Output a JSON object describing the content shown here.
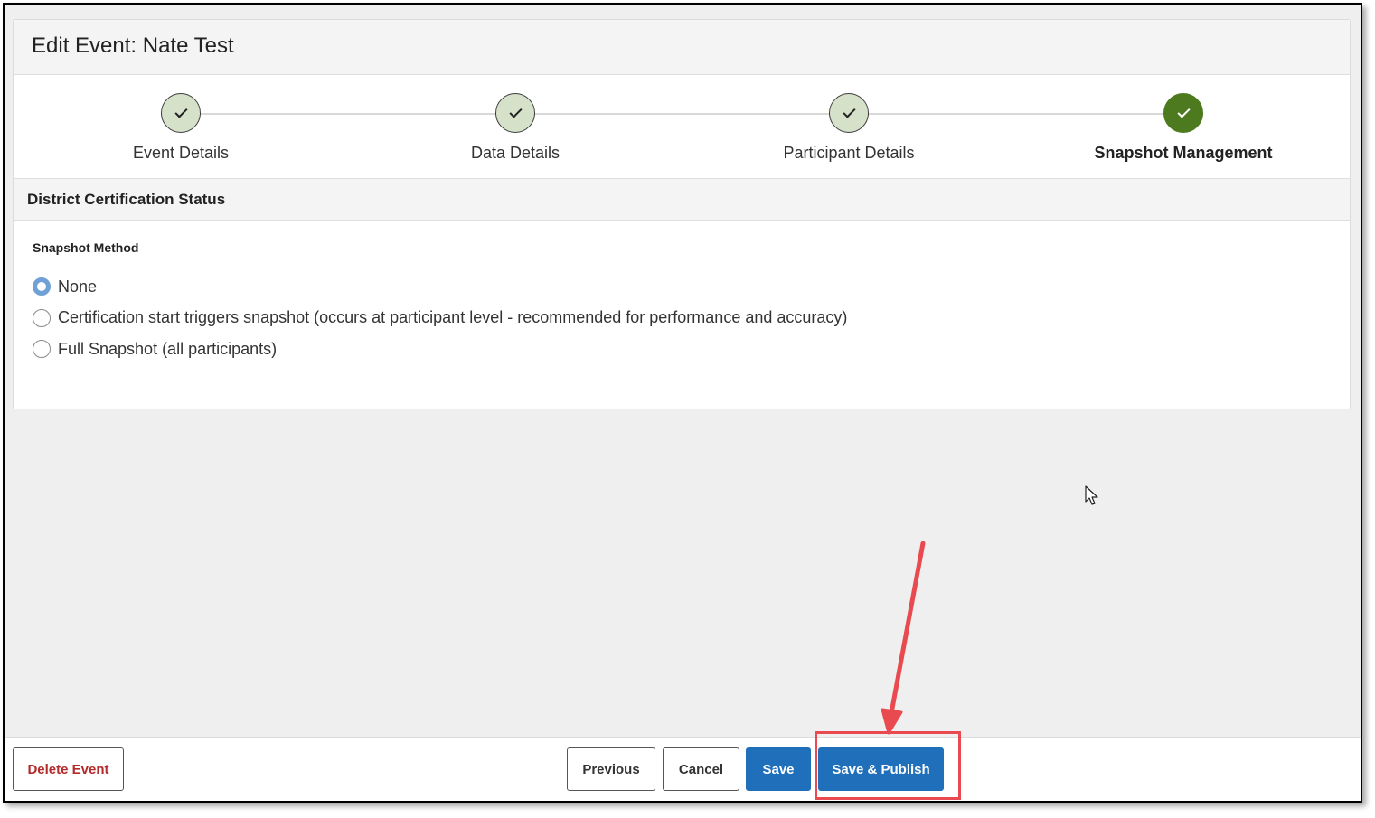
{
  "header": {
    "title": "Edit Event: Nate Test"
  },
  "stepper": {
    "steps": [
      {
        "label": "Event Details",
        "state": "complete"
      },
      {
        "label": "Data Details",
        "state": "complete"
      },
      {
        "label": "Participant Details",
        "state": "complete"
      },
      {
        "label": "Snapshot Management",
        "state": "active"
      }
    ]
  },
  "section": {
    "title": "District Certification Status",
    "field_label": "Snapshot Method",
    "options": [
      {
        "label": "None",
        "selected": true
      },
      {
        "label": "Certification start triggers snapshot (occurs at participant level - recommended for performance and accuracy)",
        "selected": false
      },
      {
        "label": "Full Snapshot (all participants)",
        "selected": false
      }
    ]
  },
  "footer": {
    "delete_label": "Delete Event",
    "previous_label": "Previous",
    "cancel_label": "Cancel",
    "save_label": "Save",
    "save_publish_label": "Save & Publish"
  },
  "colors": {
    "primary": "#1f6fba",
    "step_complete": "#d6e1c9",
    "step_active": "#4e7a1f",
    "danger_text": "#b52a2a",
    "annotation": "#e84a4f",
    "radio_checked": "#6fa0d6"
  },
  "icons": {
    "step": "check-icon",
    "pointer": "cursor-arrow-icon",
    "annotation": "red-arrow-icon"
  }
}
